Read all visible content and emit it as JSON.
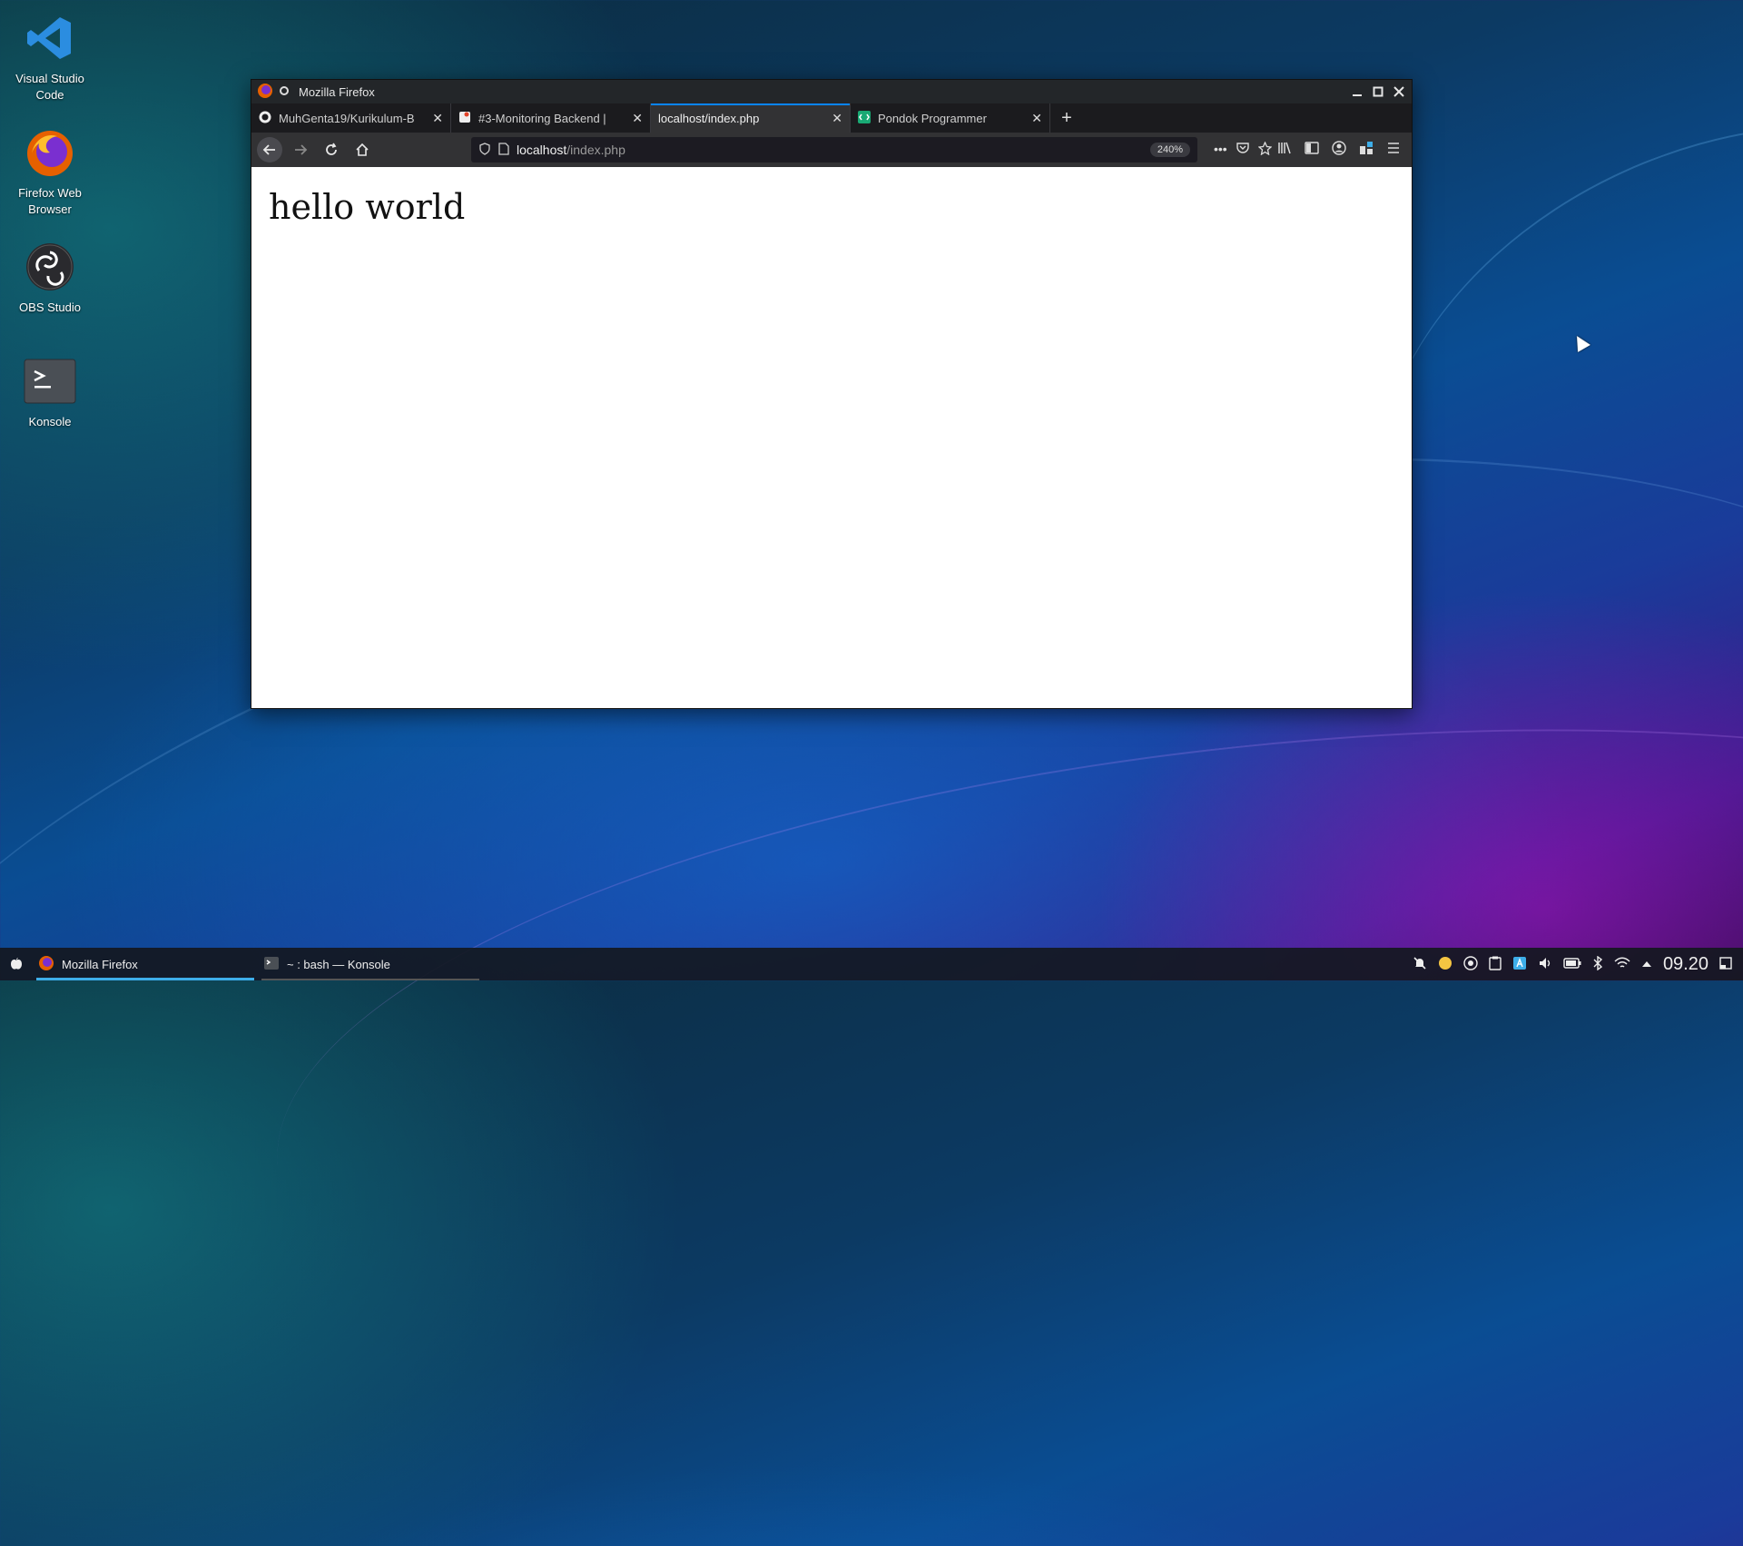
{
  "desktop": {
    "icons": [
      {
        "label": "Visual Studio Code"
      },
      {
        "label": "Firefox Web Browser"
      },
      {
        "label": "OBS Studio"
      },
      {
        "label": "Konsole"
      }
    ]
  },
  "window": {
    "title": "Mozilla Firefox",
    "tabs": [
      {
        "label": "MuhGenta19/Kurikulum-B",
        "icon": "github-icon"
      },
      {
        "label": "#3-Monitoring Backend |",
        "icon": "gitlab-icon"
      },
      {
        "label": "localhost/index.php",
        "icon": "none",
        "active": true
      },
      {
        "label": "Pondok Programmer",
        "icon": "pondok-icon"
      }
    ],
    "url": {
      "host": "localhost",
      "path": "/index.php",
      "zoom": "240%"
    }
  },
  "page": {
    "heading": "hello world"
  },
  "taskbar": {
    "tasks": [
      {
        "label": "Mozilla Firefox"
      },
      {
        "label": "~ : bash — Konsole"
      }
    ],
    "clock": "09.20"
  },
  "colors": {
    "accent": "#0a84ff",
    "task_active": "#3daee9"
  }
}
